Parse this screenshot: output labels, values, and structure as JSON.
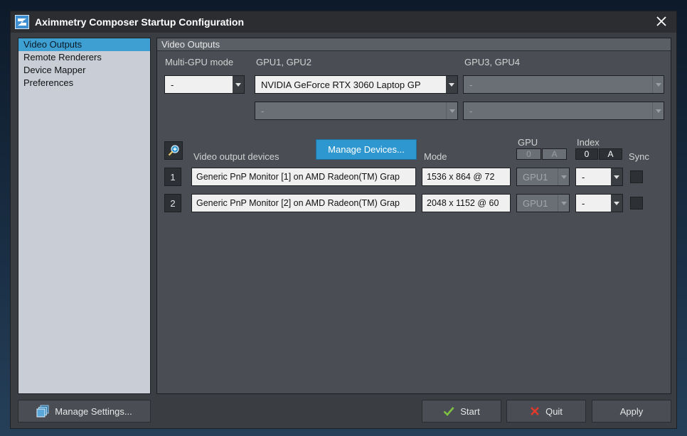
{
  "window": {
    "title": "Aximmetry Composer Startup Configuration"
  },
  "sidebar": {
    "items": [
      {
        "label": "Video Outputs",
        "active": true
      },
      {
        "label": "Remote Renderers"
      },
      {
        "label": "Device Mapper"
      },
      {
        "label": "Preferences"
      }
    ]
  },
  "panel": {
    "header": "Video Outputs",
    "multi_gpu_label": "Multi-GPU mode",
    "multi_gpu_value": "-",
    "gpu12_label": "GPU1, GPU2",
    "gpu12_value": "NVIDIA GeForce RTX 3060 Laptop GP",
    "gpu12_second_value": "-",
    "gpu34_label": "GPU3, GPU4",
    "gpu34_value": "-",
    "gpu34_second_value": "-",
    "devices_label": "Video output devices",
    "manage_devices_label": "Manage Devices...",
    "mode_label": "Mode",
    "gpu_col_label": "GPU",
    "gpu_col_opt0": "0",
    "gpu_col_optA": "A",
    "index_col_label": "Index",
    "index_col_opt0": "0",
    "index_col_optA": "A",
    "sync_label": "Sync",
    "devices": [
      {
        "num": "1",
        "name": "Generic PnP Monitor [1] on AMD Radeon(TM) Grap",
        "mode": "1536 x 864 @ 72",
        "gpu": "GPU1",
        "index": "-"
      },
      {
        "num": "2",
        "name": "Generic PnP Monitor [2] on AMD Radeon(TM) Grap",
        "mode": "2048 x 1152 @ 60",
        "gpu": "GPU1",
        "index": "-"
      }
    ]
  },
  "footer": {
    "manage_settings_label": "Manage Settings...",
    "start_label": "Start",
    "quit_label": "Quit",
    "apply_label": "Apply"
  },
  "colors": {
    "accent": "#2f97cf",
    "sidebar_active": "#3ea0d2",
    "start_icon": "#7fc241",
    "quit_icon": "#e0392b"
  },
  "icons": {
    "app": "aximmetry-logo-icon",
    "close": "close-icon",
    "zoom": "zoom-in-icon",
    "settings": "stack-icon",
    "start": "checkmark-icon",
    "quit": "x-icon"
  }
}
